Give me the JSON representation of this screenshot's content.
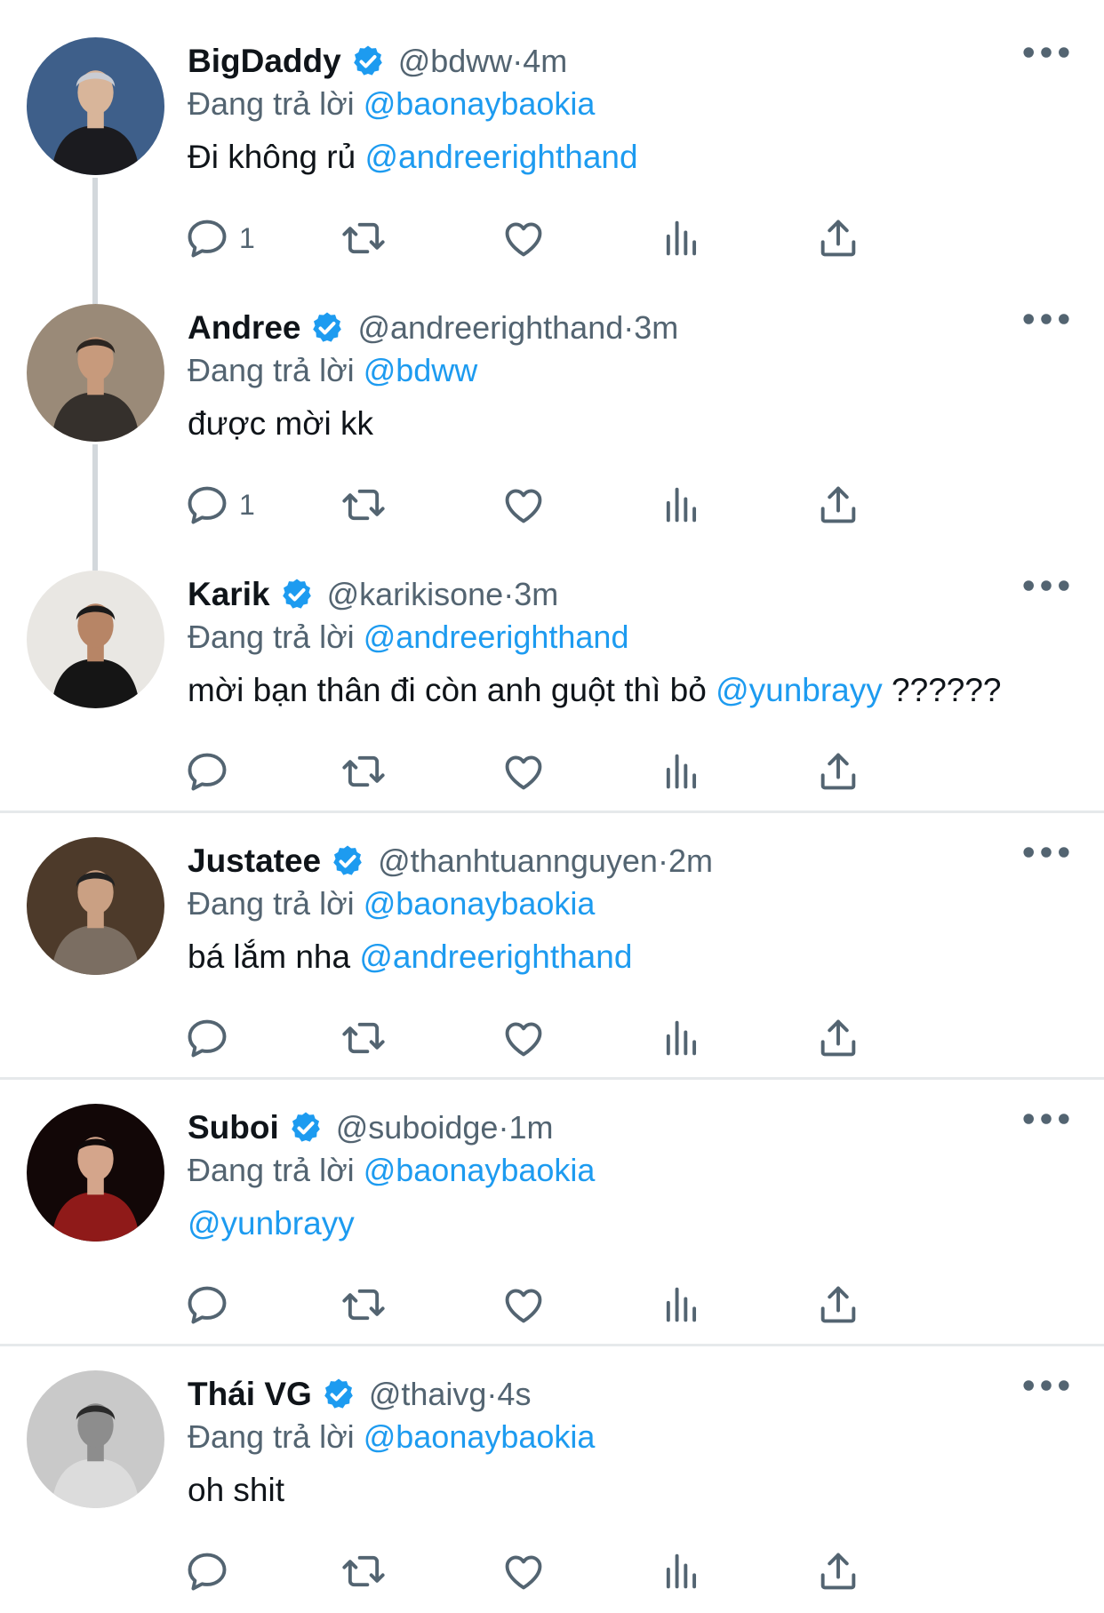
{
  "theme": {
    "link_color": "#1d9bf0",
    "verified_color": "#1d9bf0",
    "muted_color": "#536471"
  },
  "tweets": [
    {
      "name": "BigDaddy",
      "handle": "@bdww",
      "time": "4m",
      "reply_prefix": "Đang trả lời",
      "reply_to": "@baonaybaokia",
      "text": "Đi không rủ ",
      "mention": "@andreerighthand",
      "suffix": "",
      "reply_count": "1"
    },
    {
      "name": "Andree",
      "handle": "@andreerighthand",
      "time": "3m",
      "reply_prefix": "Đang trả lời",
      "reply_to": "@bdww",
      "text": "được mời kk",
      "mention": "",
      "suffix": "",
      "reply_count": "1"
    },
    {
      "name": "Karik",
      "handle": "@karikisone",
      "time": "3m",
      "reply_prefix": "Đang trả lời",
      "reply_to": "@andreerighthand",
      "text": "mời bạn thân đi còn anh guột thì bỏ ",
      "mention": "@yunbrayy",
      "suffix": " ??????",
      "reply_count": ""
    },
    {
      "name": "Justatee",
      "handle": "@thanhtuannguyen",
      "time": "2m",
      "reply_prefix": "Đang trả lời",
      "reply_to": "@baonaybaokia",
      "text": "bá lắm nha ",
      "mention": "@andreerighthand",
      "suffix": "",
      "reply_count": ""
    },
    {
      "name": "Suboi",
      "handle": "@suboidge",
      "time": "1m",
      "reply_prefix": "Đang trả lời",
      "reply_to": "@baonaybaokia",
      "text": "",
      "mention": "@yunbrayy",
      "suffix": "",
      "reply_count": ""
    },
    {
      "name": "Thái VG",
      "handle": "@thaivg",
      "time": "4s",
      "reply_prefix": "Đang trả lời",
      "reply_to": "@baonaybaokia",
      "text": "oh shit",
      "mention": "",
      "suffix": "",
      "reply_count": ""
    }
  ]
}
